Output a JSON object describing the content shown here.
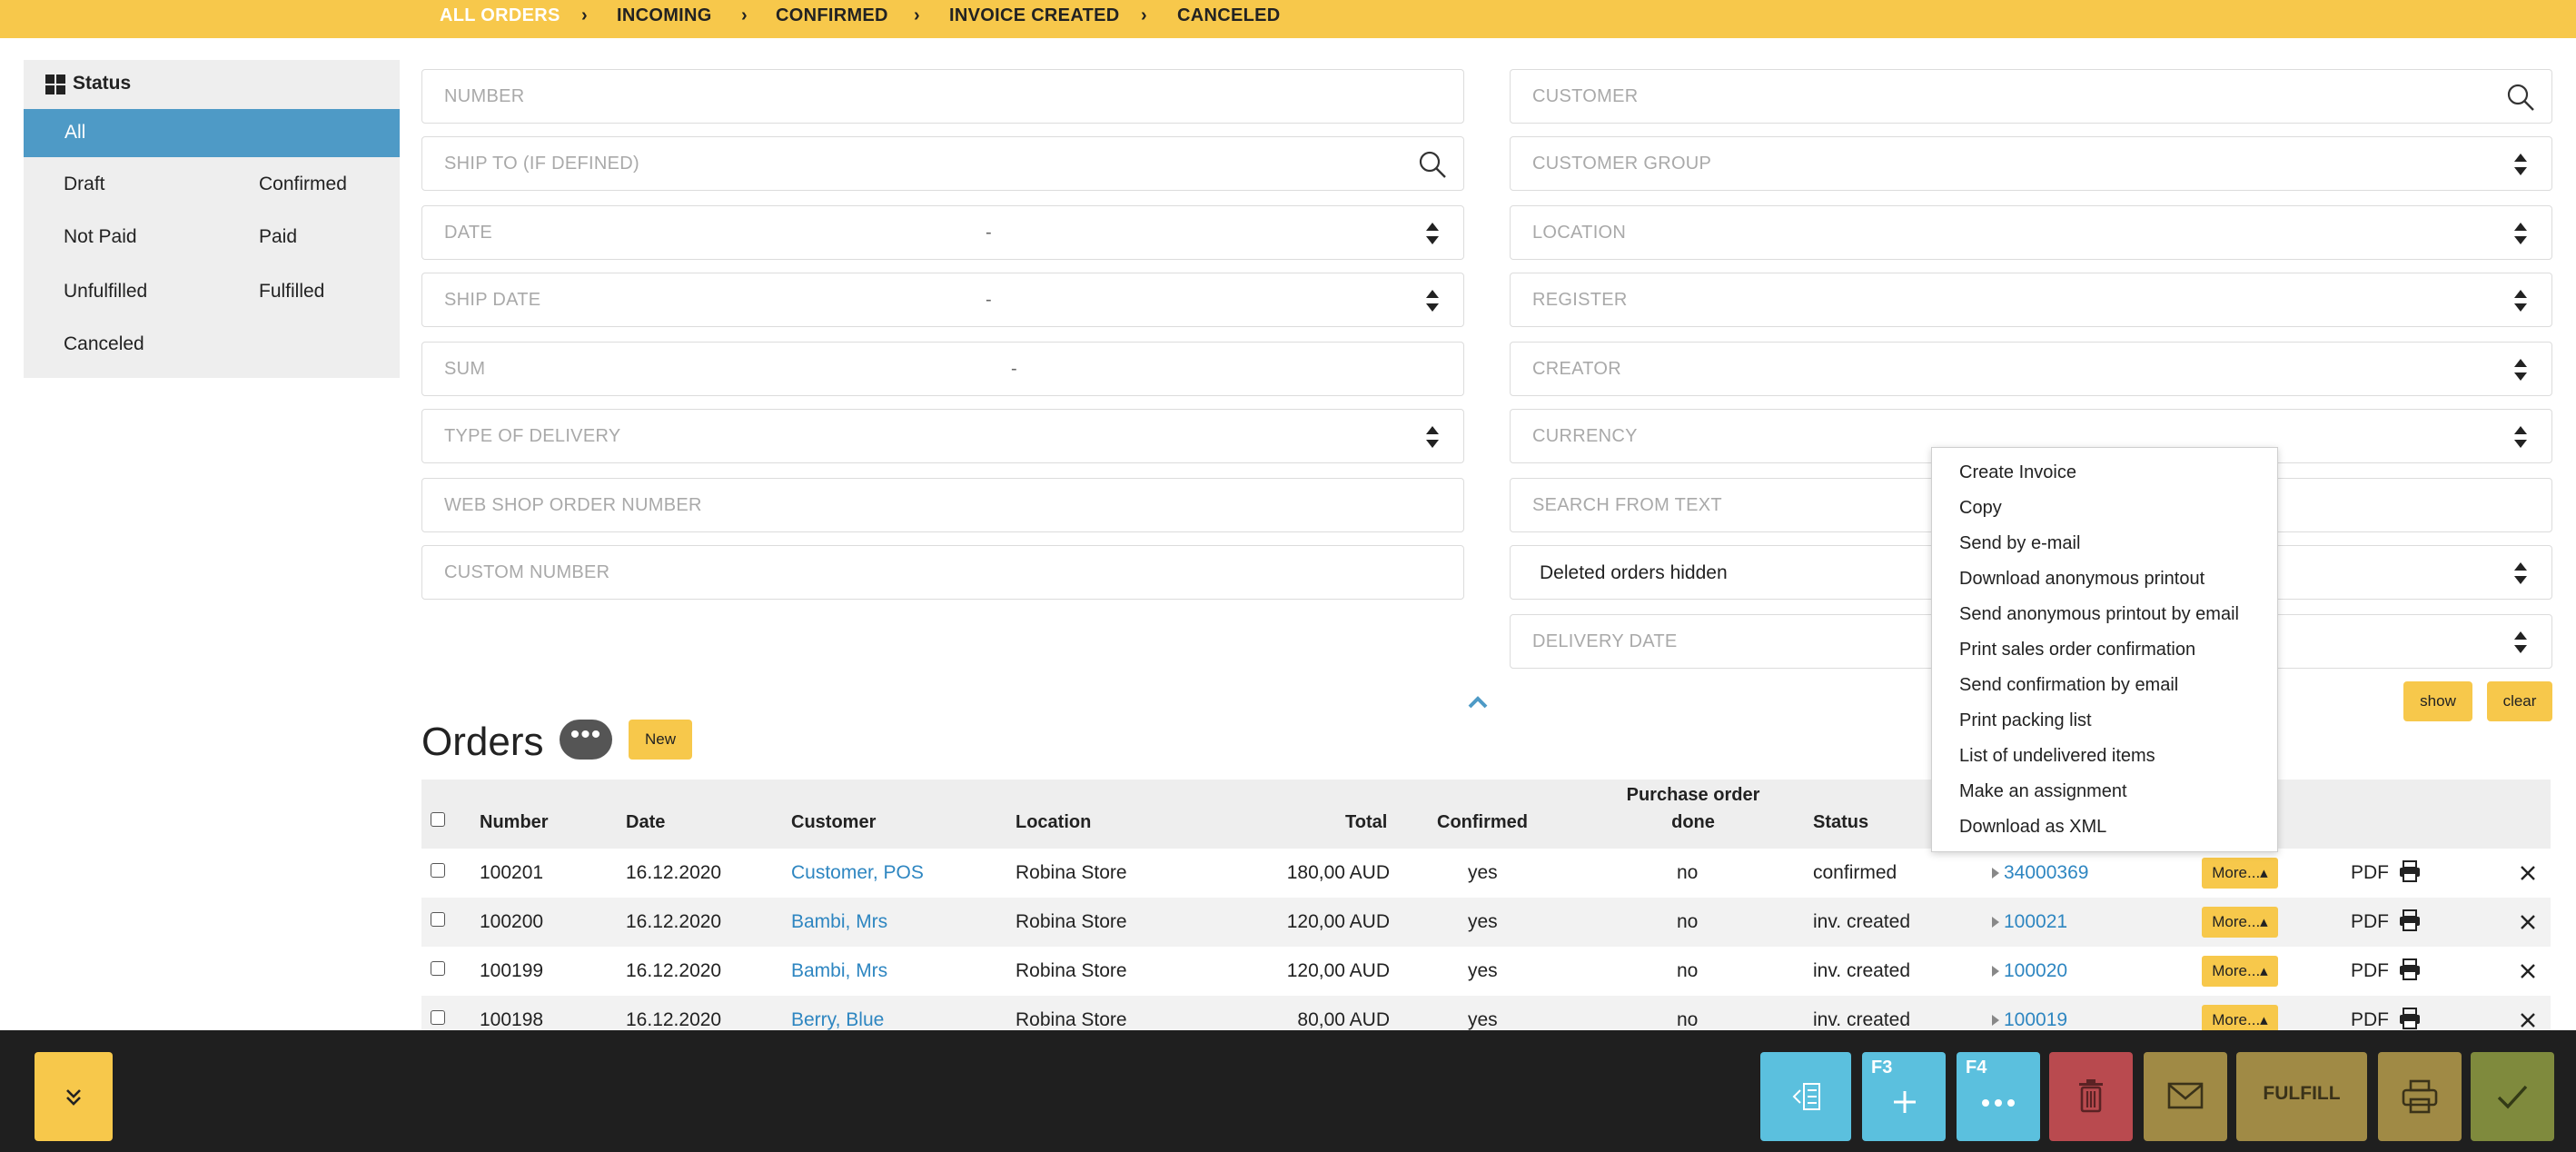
{
  "breadcrumb": {
    "items": [
      "ALL ORDERS",
      "INCOMING",
      "CONFIRMED",
      "INVOICE CREATED",
      "CANCELED"
    ],
    "separator": "›"
  },
  "sidebar": {
    "title": "Status",
    "all": "All",
    "items": [
      "Draft",
      "Confirmed",
      "Not Paid",
      "Paid",
      "Unfulfilled",
      "Fulfilled",
      "Canceled"
    ]
  },
  "filters": {
    "number": "NUMBER",
    "ship_to": "SHIP TO (IF DEFINED)",
    "date": "DATE",
    "ship_date": "SHIP DATE",
    "sum": "SUM",
    "type_of_delivery": "TYPE OF DELIVERY",
    "web_shop_order_number": "WEB SHOP ORDER NUMBER",
    "custom_number": "CUSTOM NUMBER",
    "customer": "CUSTOMER",
    "customer_group": "CUSTOMER GROUP",
    "location": "LOCATION",
    "register": "REGISTER",
    "creator": "CREATOR",
    "currency": "CURRENCY",
    "search_from_text": "SEARCH FROM TEXT",
    "deleted_orders": "Deleted orders hidden",
    "delivery_date": "DELIVERY DATE",
    "range_dash": "-",
    "show": "show",
    "clear": "clear"
  },
  "orders": {
    "title": "Orders",
    "more_dots": "•••",
    "new_label": "New",
    "columns": {
      "number": "Number",
      "date": "Date",
      "customer": "Customer",
      "location": "Location",
      "total": "Total",
      "confirmed": "Confirmed",
      "po_done_1": "Purchase order",
      "po_done_2": "done",
      "status": "Status"
    },
    "rows": [
      {
        "number": "100201",
        "date": "16.12.2020",
        "customer": "Customer, POS",
        "location": "Robina Store",
        "total": "180,00 AUD",
        "confirmed": "yes",
        "po_done": "no",
        "status": "confirmed",
        "ref": "34000369",
        "more": "More...",
        "pdf": "PDF"
      },
      {
        "number": "100200",
        "date": "16.12.2020",
        "customer": "Bambi, Mrs",
        "location": "Robina Store",
        "total": "120,00 AUD",
        "confirmed": "yes",
        "po_done": "no",
        "status": "inv. created",
        "ref": "100021",
        "more": "More...",
        "pdf": "PDF"
      },
      {
        "number": "100199",
        "date": "16.12.2020",
        "customer": "Bambi, Mrs",
        "location": "Robina Store",
        "total": "120,00 AUD",
        "confirmed": "yes",
        "po_done": "no",
        "status": "inv. created",
        "ref": "100020",
        "more": "More...",
        "pdf": "PDF"
      },
      {
        "number": "100198",
        "date": "16.12.2020",
        "customer": "Berry, Blue",
        "location": "Robina Store",
        "total": "80,00 AUD",
        "confirmed": "yes",
        "po_done": "no",
        "status": "inv. created",
        "ref": "100019",
        "more": "More...",
        "pdf": "PDF"
      }
    ]
  },
  "more_menu": {
    "items": [
      "Create Invoice",
      "Copy",
      "Send by e-mail",
      "Download anonymous printout",
      "Send anonymous printout by email",
      "Print sales order confirmation",
      "Send confirmation by email",
      "Print packing list",
      "List of undelivered items",
      "Make an assignment",
      "Download as XML"
    ]
  },
  "bottom_bar": {
    "f3": "F3",
    "f4": "F4",
    "fulfill": "FULFILL"
  },
  "colors": {
    "accent_yellow": "#f7c84b",
    "link_blue": "#2e86c1",
    "sidebar_active": "#4e9ac6",
    "action_cyan": "#5bc0de",
    "delete_red": "#b94a4f",
    "olive": "#a08a45",
    "confirm_green": "#7f8a3d"
  }
}
